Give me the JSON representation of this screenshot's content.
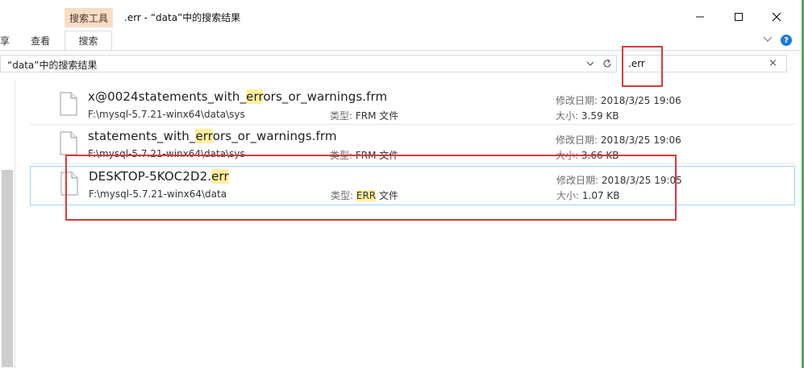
{
  "titlebar": {
    "context_tab": "搜索工具",
    "window_title": ".err - “data”中的搜索结果",
    "minimize": "minimize-icon",
    "maximize": "maximize-icon",
    "close": "close-icon"
  },
  "ribbon": {
    "tabs": [
      {
        "label": "享"
      },
      {
        "label": "查看"
      },
      {
        "label": "搜索"
      }
    ],
    "active": "搜索"
  },
  "address": {
    "path": "“data”中的搜索结果"
  },
  "search": {
    "value": ".err",
    "clear": "×"
  },
  "results": [
    {
      "name_pre": "x@0024statements_with_",
      "name_hl": "err",
      "name_post": "ors_or_warnings.frm",
      "path": "F:\\mysql-5.7.21-winx64\\data\\sys",
      "type_label": "类型:",
      "type_hl": "",
      "type_pre": "FRM",
      "type_post": " 文件",
      "date_label": "修改日期:",
      "date": "2018/3/25 19:06",
      "size_label": "大小:",
      "size": "3.59 KB"
    },
    {
      "name_pre": "statements_with_",
      "name_hl": "err",
      "name_post": "ors_or_warnings.frm",
      "path": "F:\\mysql-5.7.21-winx64\\data\\sys",
      "type_label": "类型:",
      "type_hl": "",
      "type_pre": "FRM",
      "type_post": " 文件",
      "date_label": "修改日期:",
      "date": "2018/3/25 19:06",
      "size_label": "大小:",
      "size": "3.66 KB"
    },
    {
      "name_pre": "DESKTOP-5KOC2D2.",
      "name_hl": "err",
      "name_post": "",
      "path": "F:\\mysql-5.7.21-winx64\\data",
      "type_label": "类型:",
      "type_hl": "ERR",
      "type_pre": "",
      "type_post": " 文件",
      "date_label": "修改日期:",
      "date": "2018/3/25 19:05",
      "size_label": "大小:",
      "size": "1.07 KB"
    }
  ],
  "colors": {
    "highlight": "#ffef9d",
    "annotation_red": "#d73a3a",
    "selection_border": "#99d1ff",
    "context_tab_bg": "#f8dcc6"
  }
}
